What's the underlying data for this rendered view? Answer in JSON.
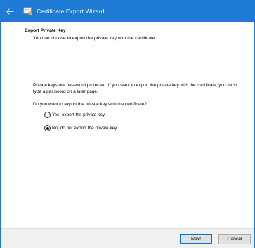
{
  "window": {
    "title": "Certificate Export Wizard"
  },
  "icons": {
    "back": "back-arrow-icon",
    "wizard": "certificate-wizard-icon"
  },
  "header": {
    "title": "Export Private Key",
    "subtitle": "You can choose to export the private key with the certificate."
  },
  "body": {
    "description": "Private keys are password protected. If you want to export the private key with the certificate, you must type a password on a later page.",
    "question": "Do you want to export the private key with the certificate?",
    "options": [
      {
        "label": "Yes, export the private key",
        "selected": false
      },
      {
        "label": "No, do not export the private key",
        "selected": true
      }
    ]
  },
  "footer": {
    "next_label": "Next",
    "cancel_label": "Cancel"
  },
  "colors": {
    "titlebar": "#1e7ad3",
    "accent": "#0078d7",
    "footer": "#f0f0f0"
  }
}
